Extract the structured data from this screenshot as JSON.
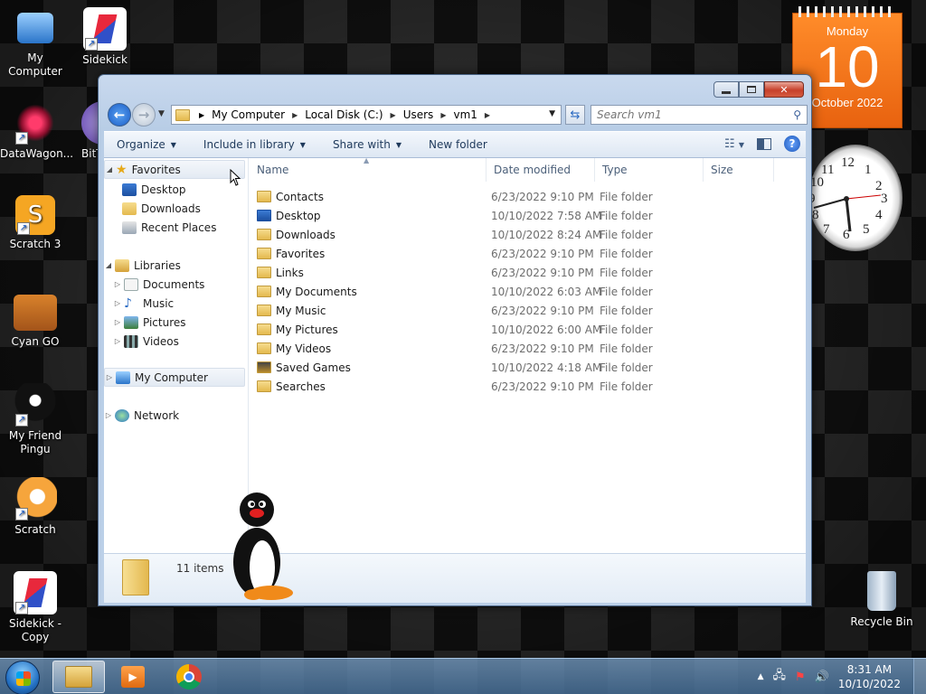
{
  "desktop": {
    "icons": [
      {
        "label": "My Computer",
        "icon": "computer-icon"
      },
      {
        "label": "Sidekick",
        "icon": "sidekick-icon"
      },
      {
        "label": "DataWagon...",
        "icon": "datawagon-icon"
      },
      {
        "label": "BitT",
        "icon": "bittorrent-icon"
      },
      {
        "label": "Scratch 3",
        "icon": "scratch3-icon"
      },
      {
        "label": "Cyan GO",
        "icon": "briefcase-icon"
      },
      {
        "label": "My Friend Pingu",
        "icon": "pingu-icon"
      },
      {
        "label": "Scratch",
        "icon": "scratch-cat-icon"
      },
      {
        "label": "Sidekick - Copy",
        "icon": "sidekick-icon"
      },
      {
        "label": "Recycle Bin",
        "icon": "recycle-bin-icon"
      }
    ]
  },
  "calendar": {
    "day": "Monday",
    "date": "10",
    "month_year": "October 2022"
  },
  "clock_gadget": {
    "numerals": [
      "12",
      "1",
      "2",
      "3",
      "4",
      "5",
      "6",
      "7",
      "8",
      "9",
      "10",
      "11"
    ]
  },
  "window": {
    "address": {
      "segments": [
        "My Computer",
        "Local Disk (C:)",
        "Users",
        "vm1"
      ]
    },
    "search": {
      "placeholder": "Search vm1"
    },
    "toolbar": {
      "organize": "Organize",
      "include": "Include in library",
      "share": "Share with",
      "newfolder": "New folder"
    },
    "nav": {
      "favorites": "Favorites",
      "desktop": "Desktop",
      "downloads": "Downloads",
      "recent": "Recent Places",
      "libraries": "Libraries",
      "documents": "Documents",
      "music": "Music",
      "pictures": "Pictures",
      "videos": "Videos",
      "mycomputer": "My Computer",
      "network": "Network"
    },
    "columns": {
      "name": "Name",
      "date": "Date modified",
      "type": "Type",
      "size": "Size"
    },
    "files": [
      {
        "name": "Contacts",
        "date": "6/23/2022 9:10 PM",
        "type": "File folder"
      },
      {
        "name": "Desktop",
        "date": "10/10/2022 7:58 AM",
        "type": "File folder"
      },
      {
        "name": "Downloads",
        "date": "10/10/2022 8:24 AM",
        "type": "File folder"
      },
      {
        "name": "Favorites",
        "date": "6/23/2022 9:10 PM",
        "type": "File folder"
      },
      {
        "name": "Links",
        "date": "6/23/2022 9:10 PM",
        "type": "File folder"
      },
      {
        "name": "My Documents",
        "date": "10/10/2022 6:03 AM",
        "type": "File folder"
      },
      {
        "name": "My Music",
        "date": "6/23/2022 9:10 PM",
        "type": "File folder"
      },
      {
        "name": "My Pictures",
        "date": "10/10/2022 6:00 AM",
        "type": "File folder"
      },
      {
        "name": "My Videos",
        "date": "6/23/2022 9:10 PM",
        "type": "File folder"
      },
      {
        "name": "Saved Games",
        "date": "10/10/2022 4:18 AM",
        "type": "File folder"
      },
      {
        "name": "Searches",
        "date": "6/23/2022 9:10 PM",
        "type": "File folder"
      }
    ],
    "status": {
      "count": "11 items"
    }
  },
  "taskbar": {
    "time": "8:31 AM",
    "date": "10/10/2022"
  },
  "colors": {
    "accent": "#1a5cc8",
    "calendar": "#f07a1e",
    "folder": "#e8c060"
  }
}
